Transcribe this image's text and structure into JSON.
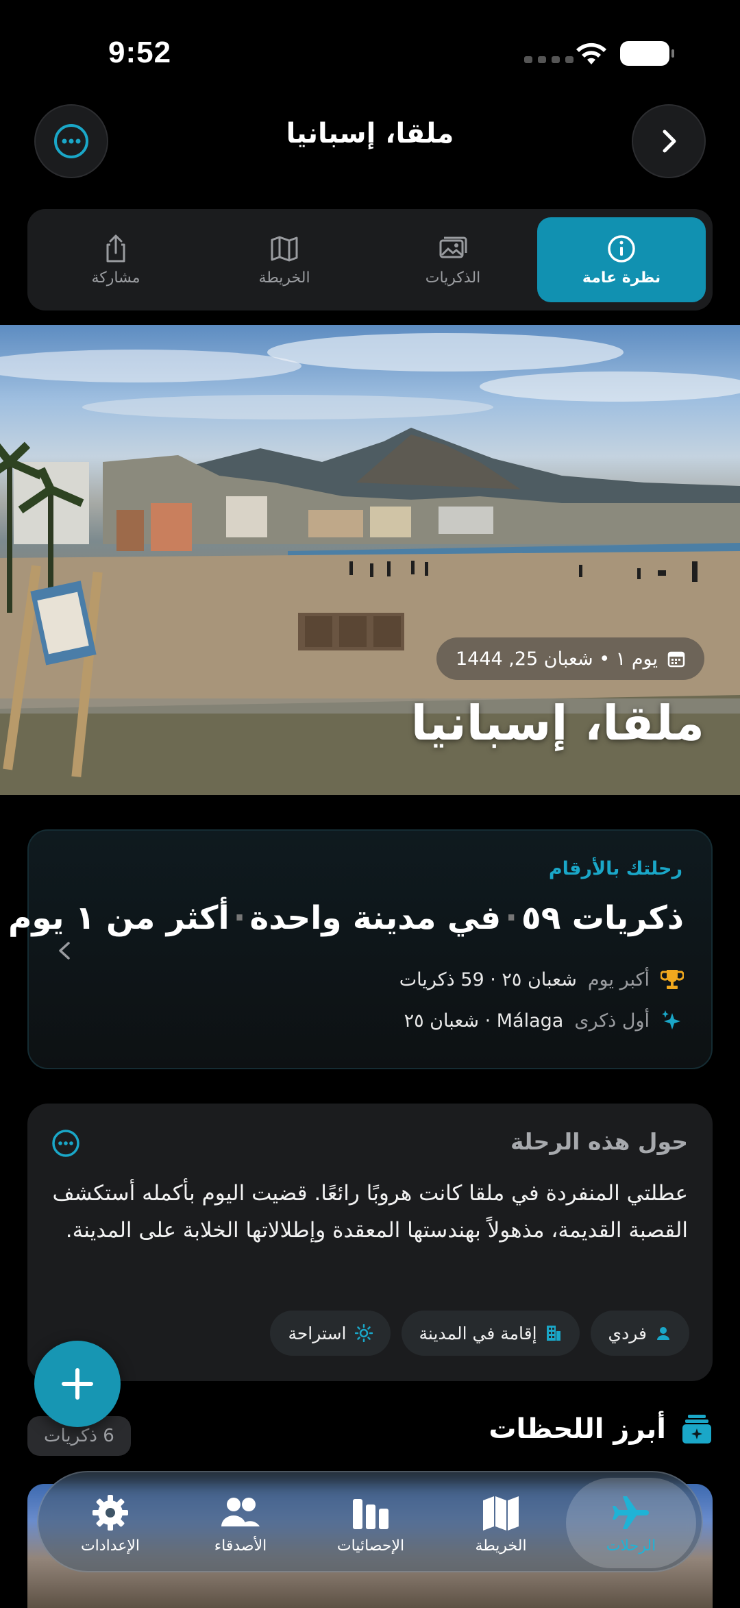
{
  "status_bar": {
    "time": "9:52"
  },
  "header": {
    "title": "ملقا، إسبانيا"
  },
  "tabs": [
    {
      "label": "نظرة عامة",
      "icon": "info-icon",
      "active": true
    },
    {
      "label": "الذكريات",
      "icon": "photos-icon",
      "active": false
    },
    {
      "label": "الخريطة",
      "icon": "map-icon",
      "active": false
    },
    {
      "label": "مشاركة",
      "icon": "share-icon",
      "active": false
    }
  ],
  "hero": {
    "date": "يوم ١ • شعبان 25, 1444",
    "title": "ملقا، إسبانيا"
  },
  "stats": {
    "label": "رحلتك بالأرقام",
    "headline": {
      "memories": "ذكريات ٥٩",
      "cities": "في مدينة واحدة",
      "days": "أكثر من ١ يوم"
    },
    "best_day": {
      "key": "أكبر يوم",
      "value": "شعبان ٢٥ · 59 ذكريات"
    },
    "first_memory": {
      "key": "أول ذكرى",
      "value": "Málaga · شعبان ٢٥"
    }
  },
  "about": {
    "title": "حول هذه الرحلة",
    "body": "عطلتي المنفردة في ملقا كانت هروبًا رائعًا. قضيت اليوم بأكمله أستكشف القصبة القديمة، مذهولاً بهندستها المعقدة وإطلالاتها الخلابة على المدينة.",
    "chips": [
      {
        "label": "فردي",
        "icon": "person-icon"
      },
      {
        "label": "إقامة في المدينة",
        "icon": "building-icon"
      },
      {
        "label": "استراحة",
        "icon": "sun-icon"
      }
    ]
  },
  "highlights": {
    "title": "أبرز اللحظات",
    "count": "6 ذكريات"
  },
  "tabbar": [
    {
      "label": "الرحلات",
      "icon": "airplane-icon",
      "active": true
    },
    {
      "label": "الخريطة",
      "icon": "map-icon",
      "active": false
    },
    {
      "label": "الإحصائيات",
      "icon": "chart-icon",
      "active": false
    },
    {
      "label": "الأصدقاء",
      "icon": "people-icon",
      "active": false
    },
    {
      "label": "الإعدادات",
      "icon": "gear-icon",
      "active": false
    }
  ],
  "colors": {
    "accent": "#1191b1",
    "accent_text": "#1aa7c8",
    "background": "#000000",
    "card": "#1b1c1e"
  }
}
